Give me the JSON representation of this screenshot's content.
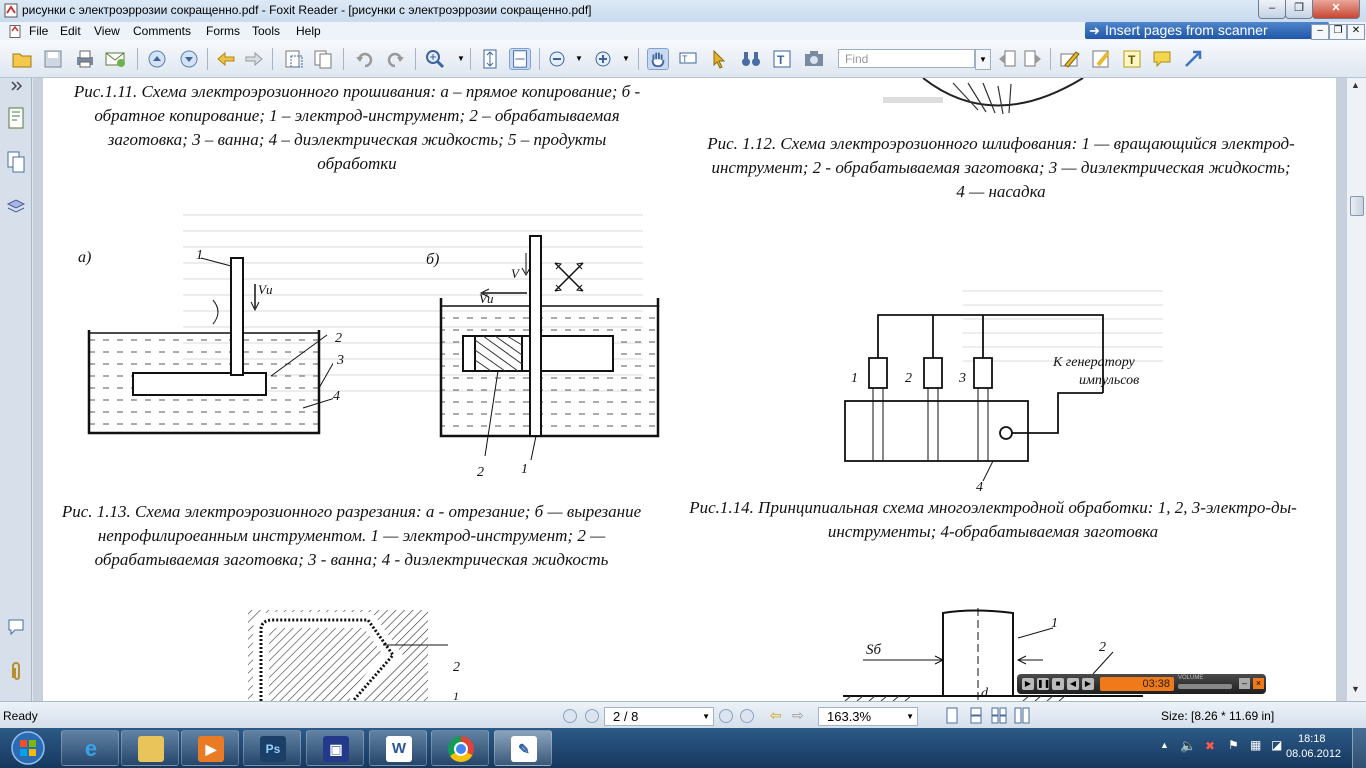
{
  "window": {
    "title": "рисунки с электроэррозии сокращенно.pdf - Foxit Reader - [рисунки с электроэррозии сокращенно.pdf]",
    "minimize_label": "–",
    "maximize_label": "❐",
    "close_label": "✕"
  },
  "menu": {
    "items": [
      "File",
      "Edit",
      "View",
      "Comments",
      "Forms",
      "Tools",
      "Help"
    ],
    "scanner_label": "Insert pages from scanner"
  },
  "toolbar": {
    "find_placeholder": "Find"
  },
  "document": {
    "caption_1_11": "Рис.1.11. Схема электроэрозионного прошивания: а – прямое копирование; б - обратное копирование; 1 – электрод-инструмент; 2 – обрабатываемая заготовка; 3 – ванна; 4 – диэлектрическая жидкость; 5 – продукты обработки",
    "caption_1_12": "Рис. 1.12. Схема электроэрозионного шлифования: 1 — вращающийся электрод-инструмент; 2 - обрабатываемая заготовка; 3 — диэлектрическая жидкость; 4 — насадка",
    "caption_1_13": "Рис. 1.13. Схема электроэрозионного разрезания: а - отрезание; б — вырезание непрофилироеанным инструментом. 1 — электрод-инструмент; 2 — обрабатываемая заготовка; 3 - ванна; 4 - диэлектрическая жидкость",
    "caption_1_14": "Рис.1.14. Принципиальная схема многоэлектродной обработки: 1, 2, 3-электро-ды- инструменты; 4-обрабатываемая заготовка",
    "fig13": {
      "label_a": "а)",
      "label_b": "б)",
      "n1": "1",
      "n2": "2",
      "n3": "3",
      "n4": "4",
      "v_label": "V",
      "vi_label": "Vи"
    },
    "fig14": {
      "n1": "1",
      "n2": "2",
      "n3": "3",
      "n4": "4",
      "generator_line1": "К генератору",
      "generator_line2": "импульсов"
    },
    "fig_bottom": {
      "n1": "1",
      "n2": "2",
      "n_small": "1",
      "s_label": "Sб",
      "d_label": "d"
    }
  },
  "media_player": {
    "time": "03:38",
    "volume_label": "VOLUME"
  },
  "status": {
    "ready": "Ready",
    "page": "2 / 8",
    "zoom": "163.3%",
    "size": "Size: [8.26 * 11.69 in]"
  },
  "taskbar": {
    "time": "18:18",
    "date": "08.06.2012",
    "apps": [
      "internet-explorer",
      "file-explorer",
      "media-player",
      "photoshop",
      "floppy-save",
      "word",
      "chrome",
      "foxit-reader"
    ]
  }
}
